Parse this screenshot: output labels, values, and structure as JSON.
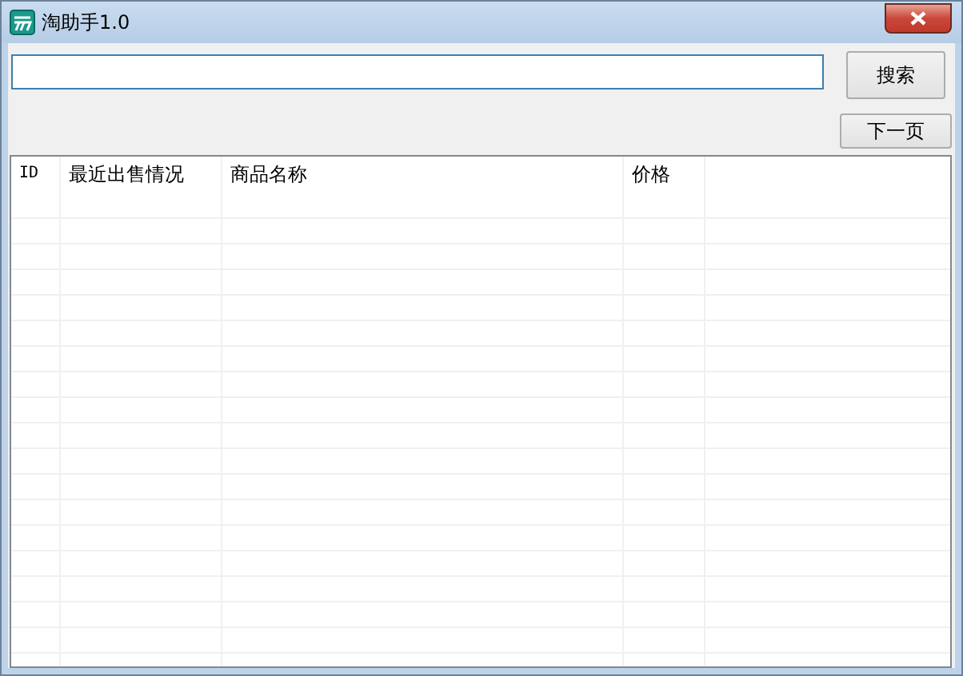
{
  "window": {
    "title": "淘助手1.0"
  },
  "search": {
    "button": "搜索"
  },
  "next_page_button": "下一页",
  "table": {
    "columns": [
      {
        "label": "ID"
      },
      {
        "label": "最近出售情况"
      },
      {
        "label": "商品名称"
      },
      {
        "label": "价格"
      }
    ]
  }
}
